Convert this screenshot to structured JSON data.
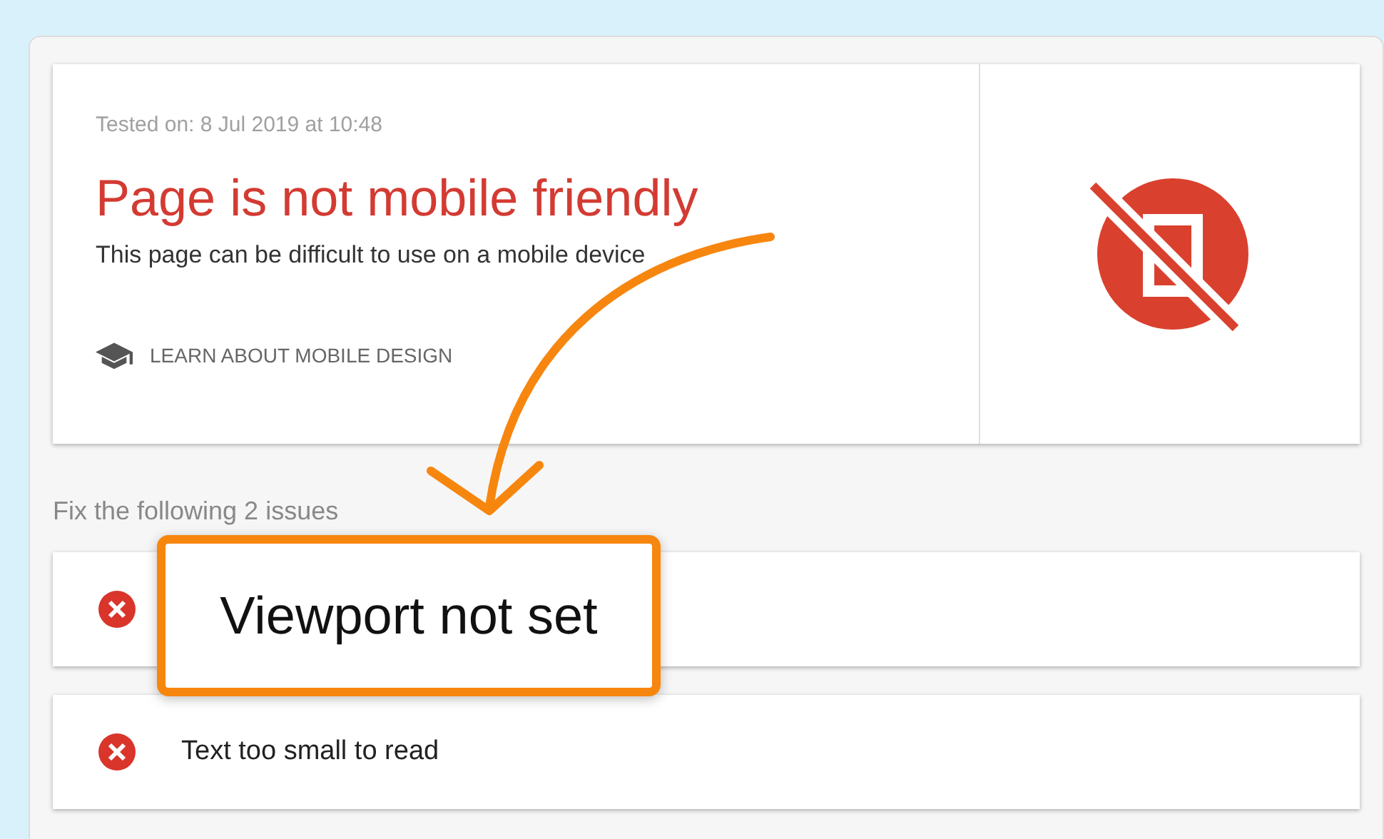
{
  "result": {
    "tested_on": "Tested on: 8 Jul 2019 at 10:48",
    "title": "Page is not mobile friendly",
    "description": "This page can be difficult to use on a mobile device",
    "learn_link": "LEARN ABOUT MOBILE DESIGN"
  },
  "issues_heading": "Fix the following 2 issues",
  "issues": [
    {
      "kind": "error"
    },
    {
      "kind": "error",
      "label": "Text too small to read"
    }
  ],
  "callout": "Viewport not set"
}
